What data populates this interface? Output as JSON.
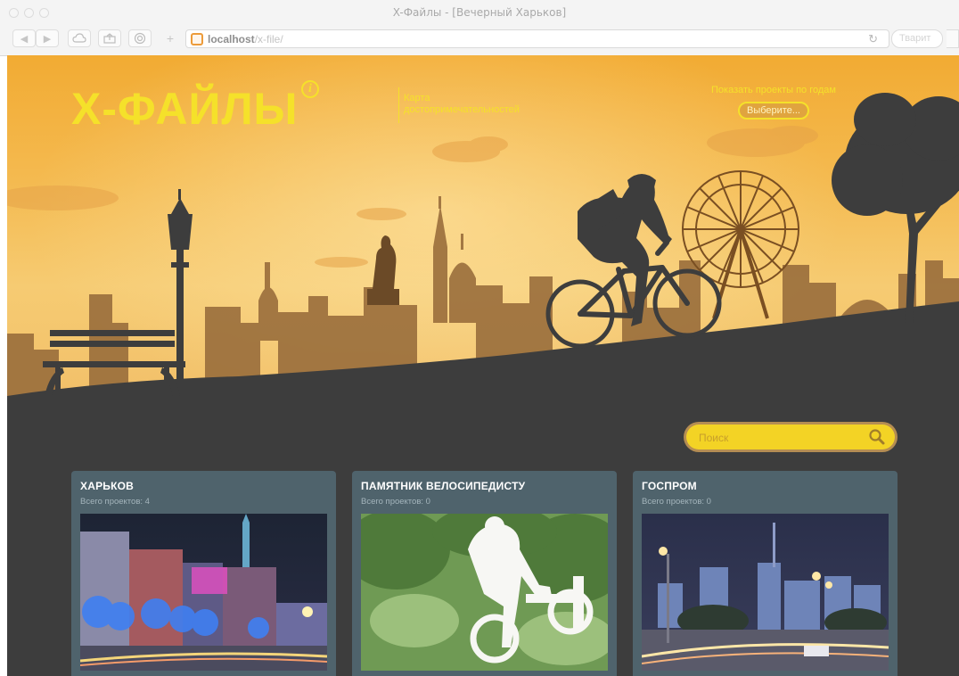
{
  "browser": {
    "window_title": "X-Файлы - [Вечерный Харьков]",
    "url_host": "localhost",
    "url_path": "/x-file/",
    "search_placeholder": "Тварит"
  },
  "header": {
    "logo": "X-ФАЙЛЫ",
    "info_icon": "info-icon",
    "map_link": "Карта достопримечательностей",
    "years_label": "Показать проекты по годам",
    "years_button": "Выберите..."
  },
  "search": {
    "placeholder": "Поиск",
    "icon": "search-icon"
  },
  "cards": [
    {
      "title": "ХАРЬКОВ",
      "count_label": "Всего проектов:",
      "count": "4",
      "image": "night-city-street-photo"
    },
    {
      "title": "ПАМЯТНИК ВЕЛОСИПЕДИСТУ",
      "count_label": "Всего проектов:",
      "count": "0",
      "image": "cyclist-monument-photo"
    },
    {
      "title": "ГОСПРОМ",
      "count_label": "Всего проектов:",
      "count": "0",
      "image": "night-skyline-photo"
    }
  ],
  "colors": {
    "accent": "#f5e12a",
    "card_bg": "#4f636c",
    "page_dark": "#3d3d3d"
  }
}
